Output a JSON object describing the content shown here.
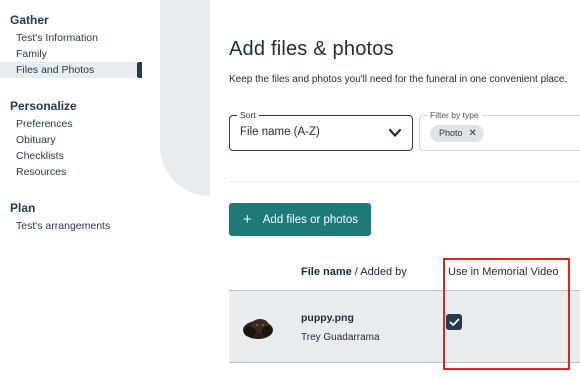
{
  "sidebar": {
    "sections": [
      {
        "heading": "Gather",
        "items": [
          "Test's Information",
          "Family",
          "Files and Photos"
        ]
      },
      {
        "heading": "Personalize",
        "items": [
          "Preferences",
          "Obituary",
          "Checklists",
          "Resources"
        ]
      },
      {
        "heading": "Plan",
        "items": [
          "Test's arrangements"
        ]
      }
    ],
    "active_item": "Files and Photos"
  },
  "main": {
    "title": "Add files & photos",
    "description": "Keep the files and photos you'll need for the funeral in one convenient place.",
    "sort": {
      "label": "Sort",
      "value": "File name (A-Z)"
    },
    "filter": {
      "label": "Filter by type",
      "chip": "Photo"
    },
    "add_button": {
      "icon": "plus-icon",
      "label": "Add files or photos"
    },
    "table": {
      "headers": {
        "file_name": "File name",
        "added_by": " / Added by",
        "use_in_video": "Use in Memorial Video"
      },
      "rows": [
        {
          "file_name": "puppy.png",
          "added_by": "Trey Guadarrama",
          "use_in_video": true
        }
      ]
    }
  },
  "colors": {
    "accent": "#1e7a78",
    "navy": "#243b53",
    "highlight": "#e2231a",
    "row_bg": "#e9ecef"
  }
}
